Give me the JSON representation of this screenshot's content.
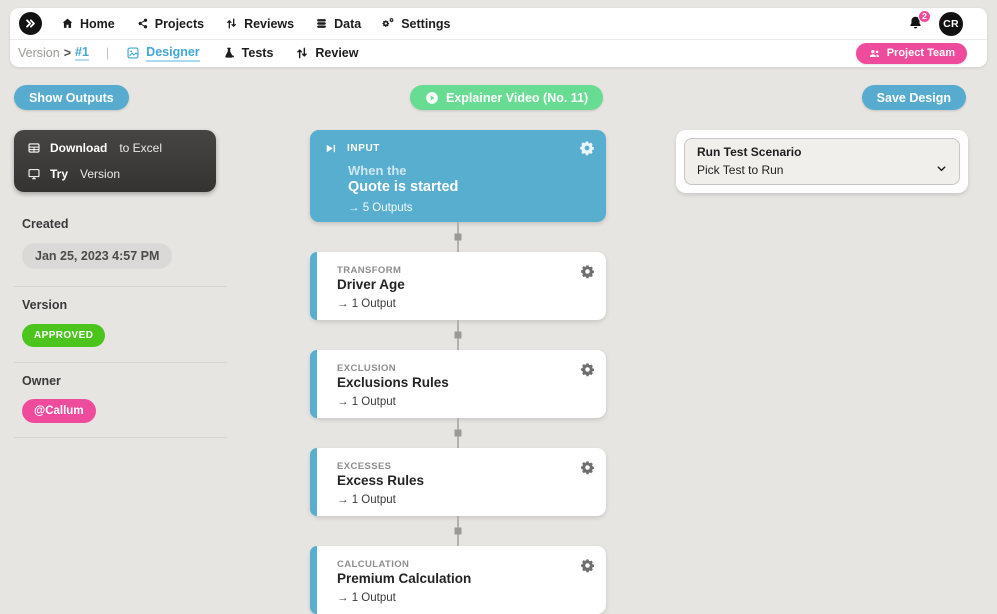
{
  "header": {
    "nav": [
      {
        "label": "Home"
      },
      {
        "label": "Projects"
      },
      {
        "label": "Reviews"
      },
      {
        "label": "Data"
      },
      {
        "label": "Settings"
      }
    ],
    "notification_count": "2",
    "avatar_initials": "CR"
  },
  "subnav": {
    "version_label": "Version",
    "version_sep": ">",
    "version_number": "#1",
    "divider": "|",
    "tabs": [
      {
        "label": "Designer",
        "active": true
      },
      {
        "label": "Tests",
        "active": false
      },
      {
        "label": "Review",
        "active": false
      }
    ],
    "project_team": "Project Team"
  },
  "toolbar": {
    "show_outputs": "Show Outputs",
    "explainer": "Explainer Video (No. 11)",
    "save_design": "Save Design"
  },
  "sidebar": {
    "menu": [
      {
        "bold": "Download",
        "rest": "to Excel"
      },
      {
        "bold": "Try",
        "rest": "Version"
      }
    ],
    "created_label": "Created",
    "created_value": "Jan 25, 2023 4:57 PM",
    "version_label": "Version",
    "version_status": "APPROVED",
    "owner_label": "Owner",
    "owner_value": "@Callum"
  },
  "flow": {
    "input": {
      "type": "INPUT",
      "subtitle": "When the",
      "title": "Quote is started",
      "outputs": "→ 5 Outputs"
    },
    "nodes": [
      {
        "type": "TRANSFORM",
        "title": "Driver Age",
        "outputs": "→ 1 Output"
      },
      {
        "type": "EXCLUSION",
        "title": "Exclusions Rules",
        "outputs": "→ 1 Output"
      },
      {
        "type": "EXCESSES",
        "title": "Excess Rules",
        "outputs": "→ 1 Output"
      },
      {
        "type": "CALCULATION",
        "title": "Premium Calculation",
        "outputs": "→ 1 Output"
      }
    ]
  },
  "test_panel": {
    "title": "Run Test Scenario",
    "value": "Pick Test to Run"
  },
  "icons": {
    "logo": "double-chevron",
    "nav": [
      "home-icon",
      "share-nodes-icon",
      "pull-request-icon",
      "database-icon",
      "gears-icon"
    ],
    "bell": "bell-icon",
    "team": "people-icon",
    "menu": [
      "spreadsheet-icon",
      "monitor-icon"
    ],
    "input_card": "skip-play-icon",
    "node_settings": "gear-icon",
    "explainer": "play-circle-icon",
    "dropdown": "chevron-down-icon"
  },
  "colors": {
    "accent_blue": "#57abce",
    "accent_green": "#68dc92",
    "approved_green": "#4cc41e",
    "accent_pink": "#ee4b9d",
    "dark_menu": "#3d3c3b",
    "page_bg": "#e7e5e2"
  }
}
